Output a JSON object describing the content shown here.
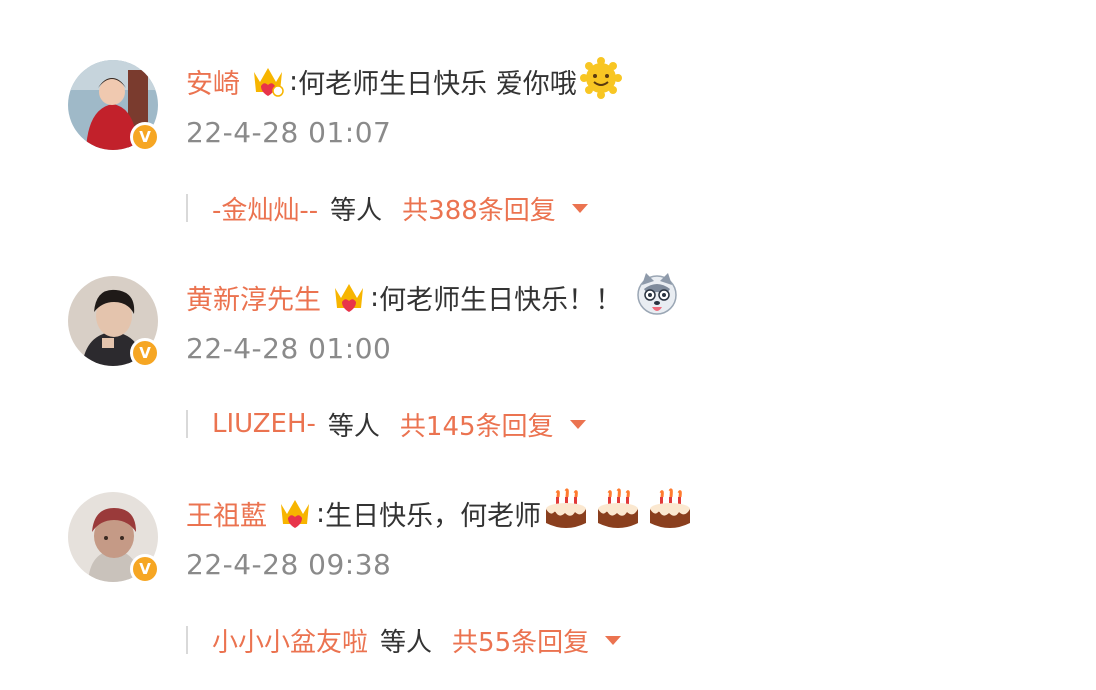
{
  "comments": [
    {
      "username": "安崎",
      "colon": ":",
      "text": "何老师生日快乐 爱你哦",
      "emoji": "smile-emoji",
      "time": "22-4-28 01:07",
      "reply_user": "-金灿灿--",
      "reply_etc": "等人",
      "reply_count": "共388条回复"
    },
    {
      "username": "黄新淳先生",
      "colon": ":",
      "text": "何老师生日快乐！！",
      "emoji": "husky-emoji",
      "time": "22-4-28 01:00",
      "reply_user": "LIUZEH-",
      "reply_etc": "等人",
      "reply_count": "共145条回复"
    },
    {
      "username": "王祖藍",
      "colon": ":",
      "text": "生日快乐，何老师",
      "emoji": "cake-emoji",
      "time": "22-4-28 09:38",
      "reply_user": "小小小盆友啦",
      "reply_etc": "等人",
      "reply_count": "共55条回复"
    }
  ],
  "colors": {
    "username": "#eb7350",
    "timestamp": "#8a8a8a",
    "badge": "#f6a623",
    "text": "#333333"
  },
  "icons": {
    "verified": "V",
    "crown": "fan-crown-icon",
    "expand": "caret-down-icon"
  }
}
